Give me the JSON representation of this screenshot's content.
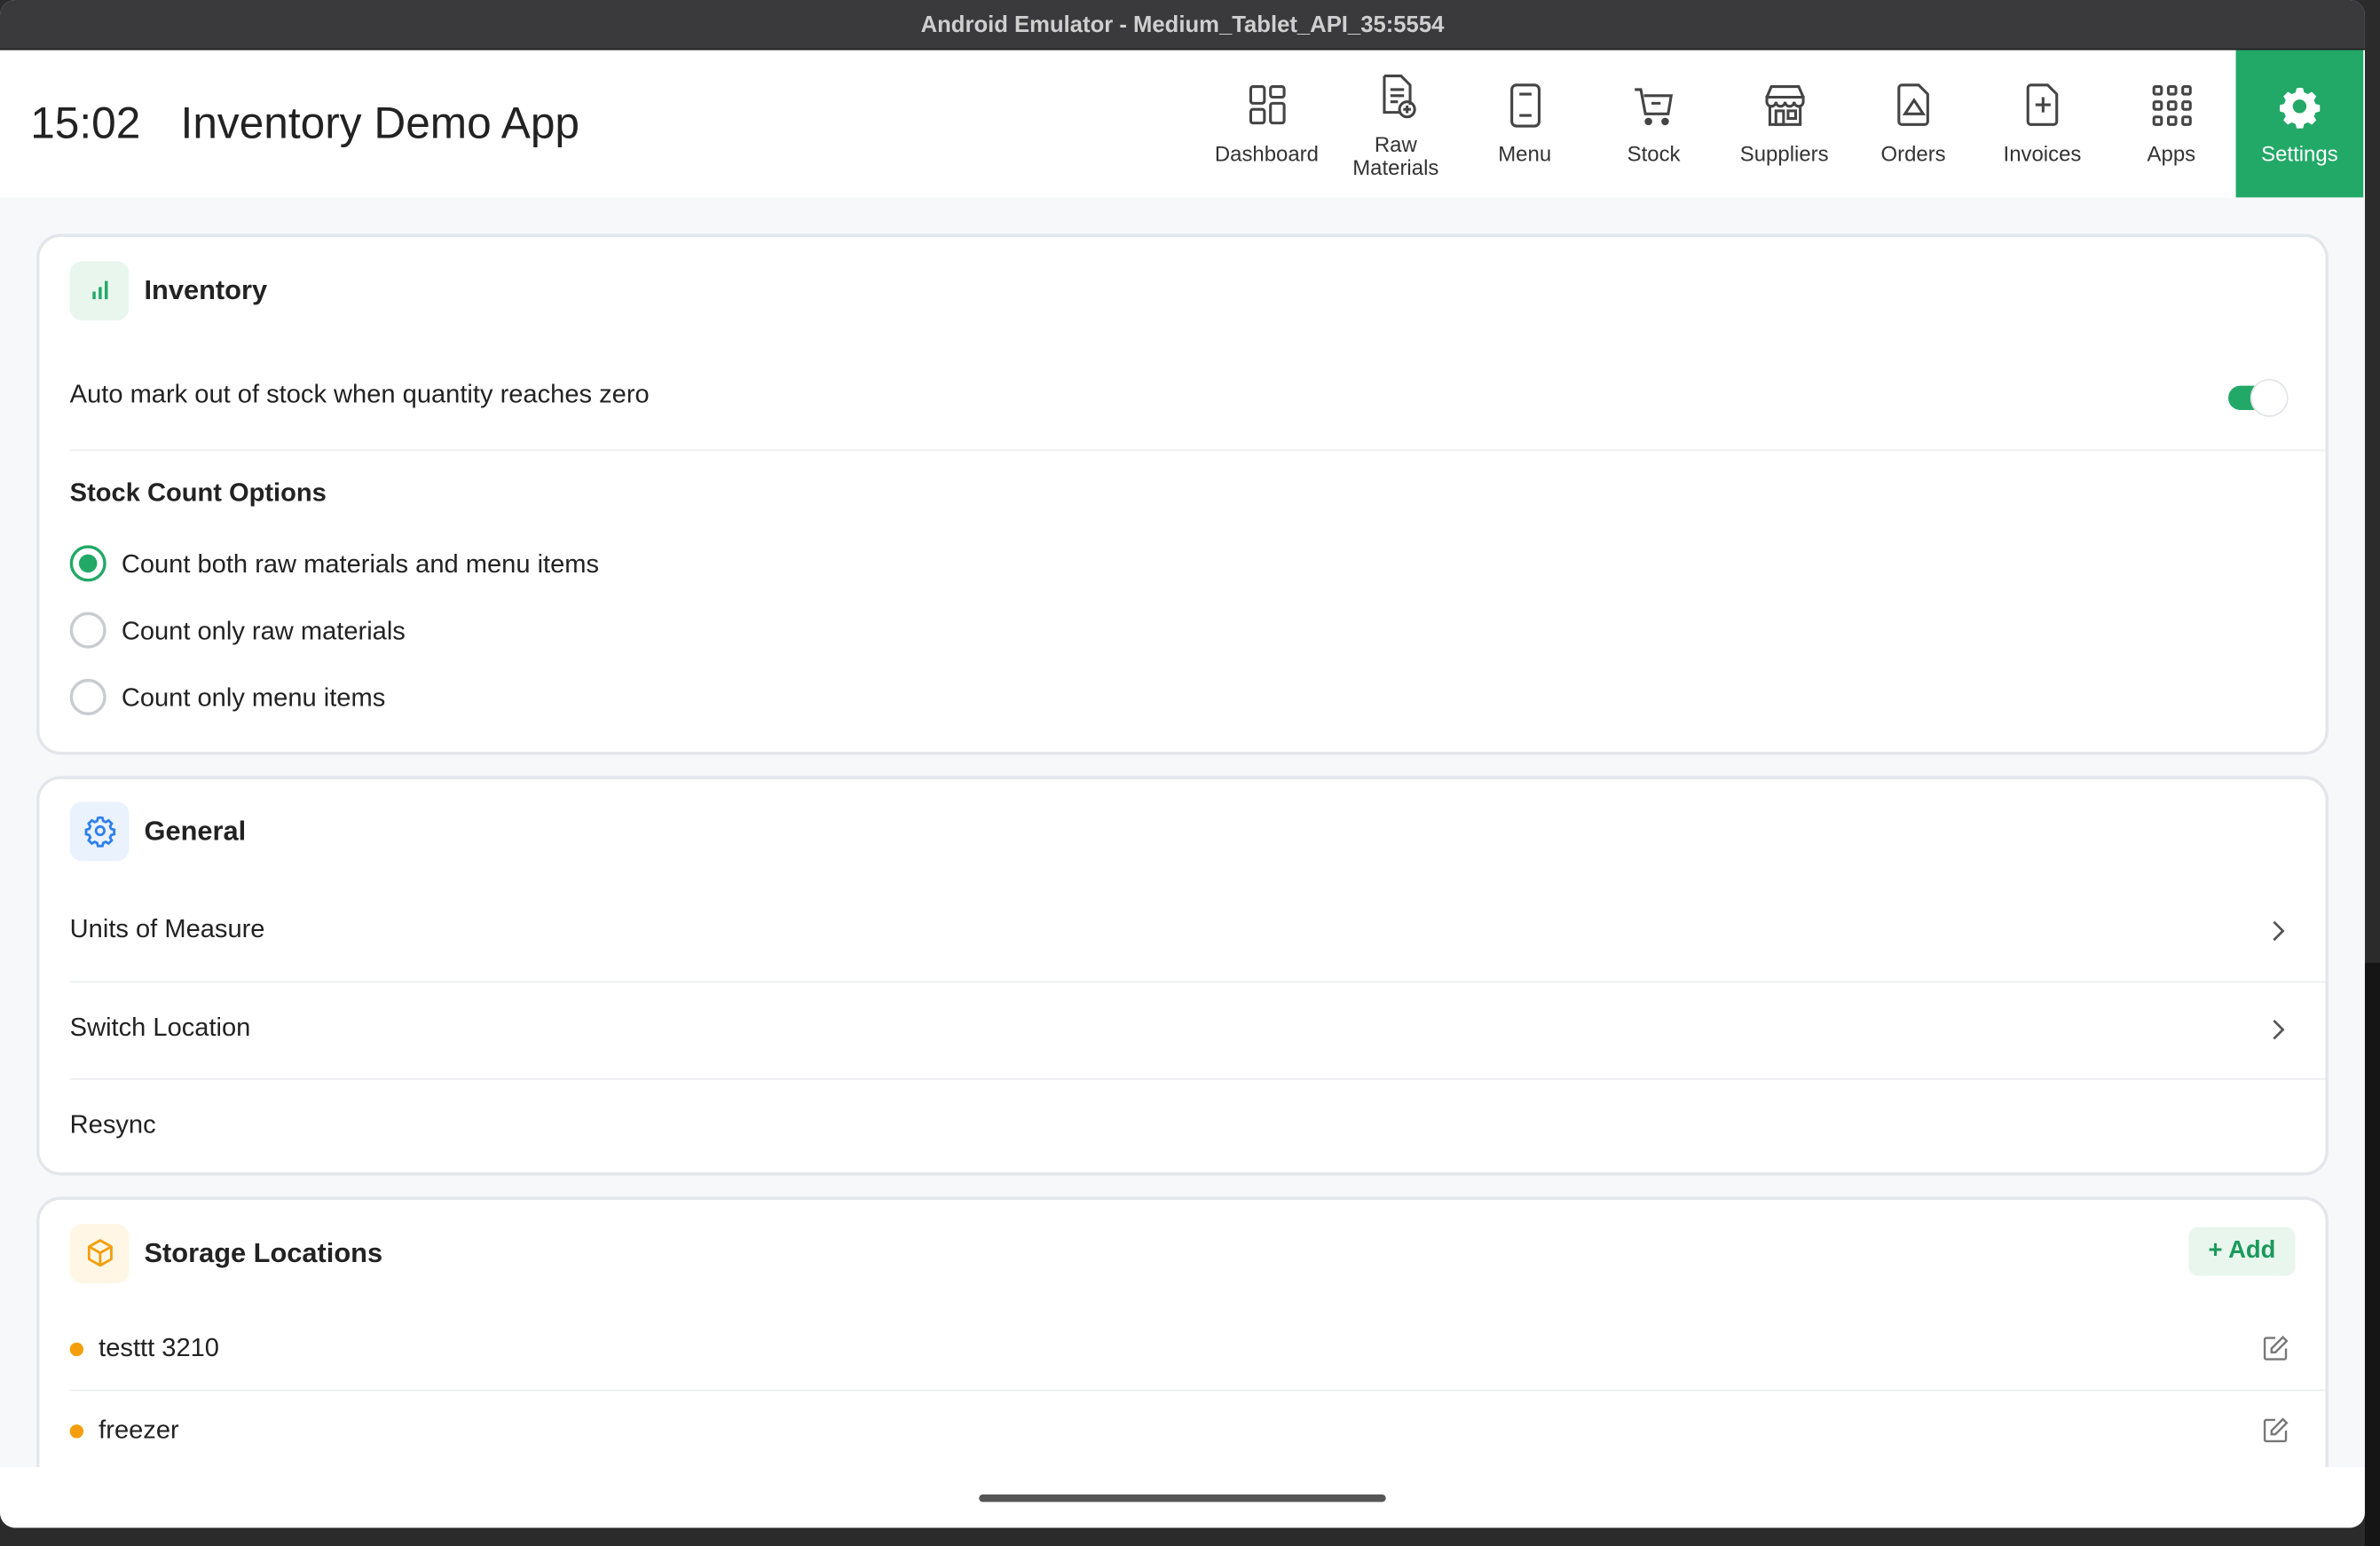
{
  "window": {
    "title": "Android Emulator - Medium_Tablet_API_35:5554"
  },
  "appbar": {
    "time": "15:02",
    "title": "Inventory Demo App",
    "nav": [
      {
        "label": "Dashboard",
        "icon": "dashboard-icon"
      },
      {
        "label": "Raw Materials",
        "icon": "raw-materials-icon"
      },
      {
        "label": "Menu",
        "icon": "menu-icon"
      },
      {
        "label": "Stock",
        "icon": "cart-icon"
      },
      {
        "label": "Suppliers",
        "icon": "store-icon"
      },
      {
        "label": "Orders",
        "icon": "orders-icon"
      },
      {
        "label": "Invoices",
        "icon": "invoice-icon"
      },
      {
        "label": "Apps",
        "icon": "apps-grid-icon"
      },
      {
        "label": "Settings",
        "icon": "gear-icon",
        "active": true
      }
    ]
  },
  "inventory": {
    "title": "Inventory",
    "auto_mark_label": "Auto mark out of stock when quantity reaches zero",
    "auto_mark_enabled": true,
    "stock_count_title": "Stock Count Options",
    "options": [
      {
        "label": "Count both raw materials and menu items",
        "selected": true
      },
      {
        "label": "Count only raw materials",
        "selected": false
      },
      {
        "label": "Count only menu items",
        "selected": false
      }
    ]
  },
  "general": {
    "title": "General",
    "items": [
      {
        "label": "Units of Measure",
        "chevron": true
      },
      {
        "label": "Switch Location",
        "chevron": true
      },
      {
        "label": "Resync",
        "chevron": false
      }
    ]
  },
  "storage": {
    "title": "Storage Locations",
    "add_label": "+ Add",
    "locations": [
      {
        "name": "testtt 3210"
      },
      {
        "name": "freezer"
      }
    ]
  },
  "colors": {
    "accent": "#22a867",
    "location_dot": "#f59e0b",
    "general_icon": "#2f80ed"
  }
}
